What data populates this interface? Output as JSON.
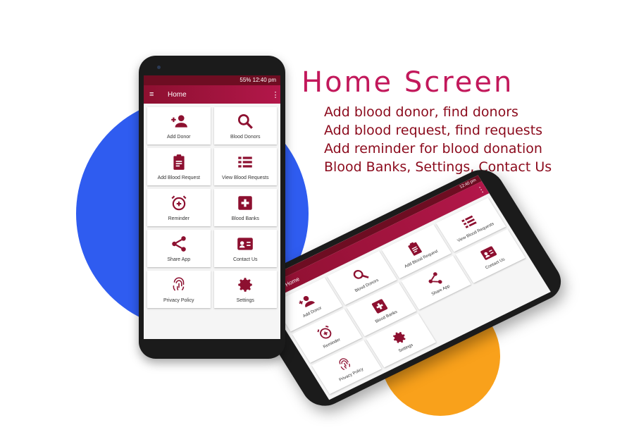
{
  "headline": "Home Screen",
  "features": [
    "Add blood donor, find donors",
    "Add blood request, find requests",
    "Add reminder for blood donation",
    "Blood Banks, Settings, Contact Us"
  ],
  "colors": {
    "accent": "#8d1030",
    "headline": "#c2185b",
    "blue_blob": "#2f5cf0",
    "orange_blob": "#f9a11b"
  },
  "phone": {
    "status": "55% 12:40 pm",
    "appbar_title": "Home",
    "menu_icon": "≡",
    "overflow_icon": "⋮",
    "tiles": [
      {
        "label": "Add Donor",
        "icon": "add-person-icon"
      },
      {
        "label": "Blood Donors",
        "icon": "search-icon"
      },
      {
        "label": "Add Blood Request",
        "icon": "clipboard-icon"
      },
      {
        "label": "View Blood Requests",
        "icon": "list-icon"
      },
      {
        "label": "Reminder",
        "icon": "alarm-icon"
      },
      {
        "label": "Blood Banks",
        "icon": "medical-cross-icon"
      },
      {
        "label": "Share App",
        "icon": "share-icon"
      },
      {
        "label": "Contact Us",
        "icon": "contact-card-icon"
      },
      {
        "label": "Privacy Policy",
        "icon": "fingerprint-icon"
      },
      {
        "label": "Settings",
        "icon": "gear-icon"
      }
    ]
  },
  "tilted_phone": {
    "status": "12:40 pm",
    "appbar_title": "Home",
    "menu_icon": "≡",
    "overflow_icon": "⋮",
    "tiles": [
      {
        "label": "Add Donor",
        "icon": "add-person-icon"
      },
      {
        "label": "Blood Donors",
        "icon": "search-icon"
      },
      {
        "label": "Add Blood Request",
        "icon": "clipboard-icon"
      },
      {
        "label": "View Blood Requests",
        "icon": "list-icon"
      },
      {
        "label": "Reminder",
        "icon": "alarm-icon"
      },
      {
        "label": "Blood Banks",
        "icon": "medical-cross-icon"
      },
      {
        "label": "Share App",
        "icon": "share-icon"
      },
      {
        "label": "Contact Us",
        "icon": "contact-card-icon"
      },
      {
        "label": "Privacy Policy",
        "icon": "fingerprint-icon"
      },
      {
        "label": "Settings",
        "icon": "gear-icon"
      }
    ]
  }
}
